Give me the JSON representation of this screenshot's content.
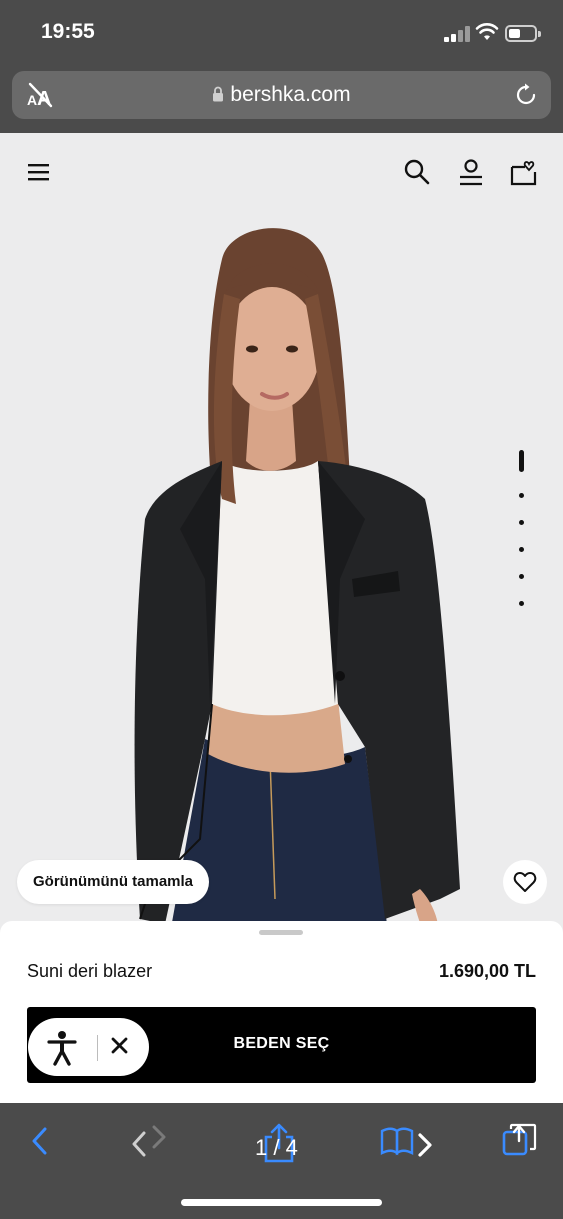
{
  "status_bar": {
    "time": "19:55"
  },
  "browser": {
    "reader_icon": "aa-reader-icon",
    "domain": "bershka.com",
    "page_counter": "1 / 4"
  },
  "header": {
    "icons": [
      "hamburger-menu-icon",
      "search-icon",
      "user-icon",
      "bag-heart-icon"
    ]
  },
  "product": {
    "image_subject": "product-photo",
    "complete_look_label": "Görünümünü tamamla",
    "name": "Suni deri blazer",
    "price": "1.690,00 TL",
    "size_button_label": "BEDEN SEÇ",
    "gallery_images_total": 6,
    "gallery_active_index": 0
  },
  "colors": {
    "chrome": "#4b4b4b",
    "page_bg": "#ececed",
    "ios_blue": "#3a8bff",
    "button": "#000000"
  }
}
